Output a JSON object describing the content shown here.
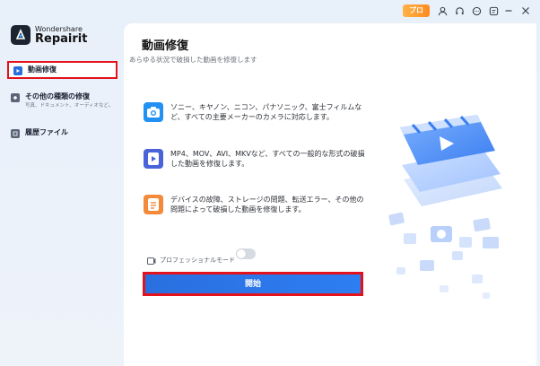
{
  "app": {
    "brand": "Wondershare",
    "product": "Repairit",
    "pro_badge": "プロ"
  },
  "titlebar": {
    "icons": [
      "user-icon",
      "headset-icon",
      "chat-icon",
      "info-icon",
      "minimize-icon",
      "close-icon"
    ]
  },
  "sidebar": {
    "items": [
      {
        "label": "動画修復",
        "sub": "",
        "icon": "video-repair-icon",
        "active": true
      },
      {
        "label": "その他の種類の修復",
        "sub": "写真、ドキュメント、オーディオなど。",
        "icon": "other-repair-icon",
        "active": false
      },
      {
        "label": "履歴ファイル",
        "sub": "",
        "icon": "history-icon",
        "active": false
      }
    ]
  },
  "main": {
    "title": "動画修復",
    "subtitle": "あらゆる状況で破損した動画を修復します",
    "features": [
      {
        "icon": "camera-icon",
        "text": "ソニー、キヤノン、ニコン、パナソニック、富士フィルムなど、すべての主要メーカーのカメラに対応します。"
      },
      {
        "icon": "video-file-icon",
        "text": "MP4、MOV、AVI、MKVなど、すべての一般的な形式の破損した動画を修復します。"
      },
      {
        "icon": "document-icon",
        "text": "デバイスの故障、ストレージの問題、転送エラー、その他の問題によって破損した動画を修復します。"
      }
    ],
    "pro_mode_label": "プロフェッショナルモード",
    "pro_mode_enabled": false,
    "start_label": "開始"
  },
  "colors": {
    "accent": "#2a6fe0",
    "highlight": "#e3121c",
    "pro_badge": "#ff9a2e"
  }
}
